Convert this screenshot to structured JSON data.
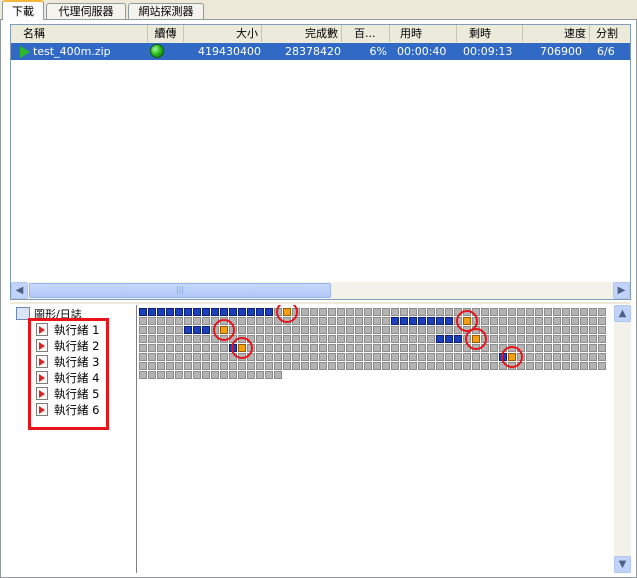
{
  "tabs": [
    "下載",
    "代理伺服器",
    "網站探測器"
  ],
  "list": {
    "columns": [
      "名稱",
      "續傳",
      "大小",
      "完成數",
      "百...",
      "用時",
      "剩時",
      "速度",
      "分割"
    ],
    "row": {
      "name": "test_400m.zip",
      "size": "419430400",
      "completed": "28378420",
      "percent": "6%",
      "elapsed": "00:00:40",
      "remaining": "00:09:13",
      "speed": "706900",
      "splits": "6/6"
    }
  },
  "tree": {
    "root": "圖形/日誌",
    "threads": [
      "執行緒 1",
      "執行緒 2",
      "執行緒 3",
      "執行緒 4",
      "執行緒 5",
      "執行緒 6"
    ]
  },
  "progress": 0.0677,
  "colors": {
    "selection": "#316ac5",
    "block_done": "#1c3fbc",
    "block_active": "#f5a010",
    "block_pending": "#b4b4b4",
    "highlight": "#e8141a"
  },
  "icons": [
    "play-icon",
    "green-ball-icon",
    "chevron-left-icon",
    "chevron-right-icon",
    "chevron-up-icon",
    "chevron-down-icon"
  ]
}
